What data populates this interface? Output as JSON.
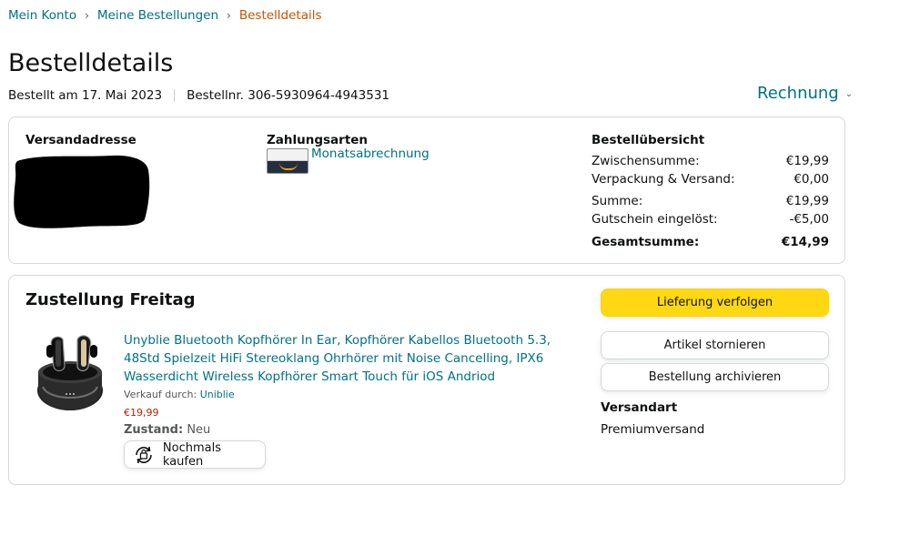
{
  "breadcrumb": {
    "items": [
      "Mein Konto",
      "Meine Bestellungen"
    ],
    "current": "Bestelldetails",
    "separator": "›"
  },
  "page": {
    "title": "Bestelldetails",
    "ordered_on": "Bestellt am 17. Mai 2023",
    "order_number": "Bestellnr. 306-5930964-4943531",
    "invoice_label": "Rechnung"
  },
  "summary": {
    "shipping_address_heading": "Versandadresse",
    "payment_heading": "Zahlungsarten",
    "payment_method": "Monatsabrechnung",
    "overview_heading": "Bestellübersicht",
    "lines": [
      {
        "label": "Zwischensumme:",
        "value": "€19,99"
      },
      {
        "label": "Verpackung & Versand:",
        "value": "€0,00"
      },
      {
        "label": "Summe:",
        "value": "€19,99"
      },
      {
        "label": "Gutschein eingelöst:",
        "value": "-€5,00"
      }
    ],
    "grand_total": {
      "label": "Gesamtsumme:",
      "value": "€14,99"
    }
  },
  "shipment": {
    "delivery_title": "Zustellung Freitag",
    "product_title": "Unyblie Bluetooth Kopfhörer In Ear, Kopfhörer Kabellos Bluetooth 5.3, 48Std Spielzeit HiFi Stereoklang Ohrhörer mit Noise Cancelling, IPX6 Wasserdicht Wireless Kopfhörer Smart Touch für iOS Andriod",
    "seller_prefix": "Verkauf durch:",
    "seller_name": "Uniblie",
    "price": "€19,99",
    "condition_label": "Zustand:",
    "condition_value": "Neu",
    "buy_again_label": "Nochmals kaufen",
    "track_button": "Lieferung verfolgen",
    "cancel_button": "Artikel stornieren",
    "archive_button": "Bestellung archivieren",
    "shipping_type_label": "Versandart",
    "shipping_type_value": "Premiumversand"
  },
  "colors": {
    "link": "#007185",
    "current_crumb": "#c45500",
    "price": "#b12704",
    "primary_button": "#ffd814",
    "border": "#d5d9d9"
  }
}
